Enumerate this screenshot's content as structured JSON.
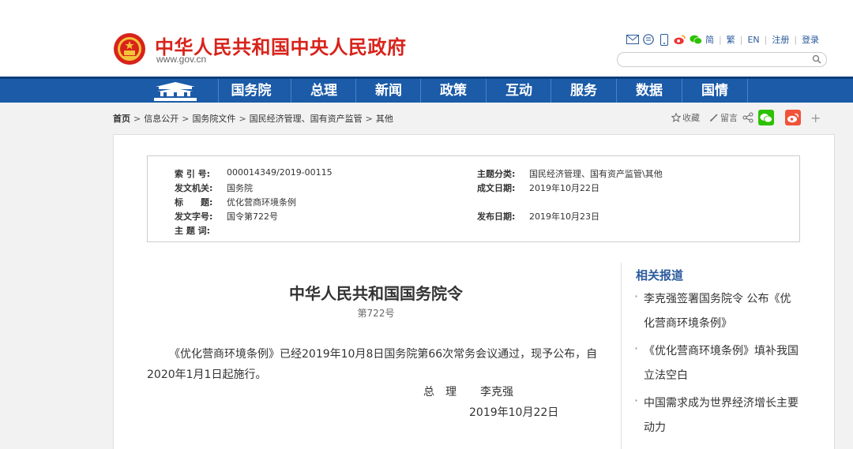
{
  "header": {
    "site_title": "中华人民共和国中央人民政府",
    "site_url": "www.gov.cn",
    "lang_links": [
      "简",
      "繁",
      "EN",
      "注册",
      "登录"
    ],
    "search_placeholder": ""
  },
  "nav": {
    "items": [
      "国务院",
      "总理",
      "新闻",
      "政策",
      "互动",
      "服务",
      "数据",
      "国情"
    ]
  },
  "breadcrumb": {
    "items": [
      "首页",
      "信息公开",
      "国务院文件",
      "国民经济管理、国有资产监管",
      "其他"
    ]
  },
  "share": {
    "favorite": "收藏",
    "comment": "留言"
  },
  "meta": {
    "index_no_label": "索 引 号:",
    "index_no": "000014349/2019-00115",
    "topic_label": "主题分类:",
    "topic": "国民经济管理、国有资产监管\\其他",
    "issuer_label": "发文机关:",
    "issuer": "国务院",
    "created_label": "成文日期:",
    "created": "2019年10月22日",
    "title_label": "标　　题:",
    "title": "优化营商环境条例",
    "doc_no_label": "发文字号:",
    "doc_no": "国令第722号",
    "published_label": "发布日期:",
    "published": "2019年10月23日",
    "keywords_label": "主 题 词:"
  },
  "document": {
    "title": "中华人民共和国国务院令",
    "number": "第722号",
    "body": "《优化营商环境条例》已经2019年10月8日国务院第66次常务会议通过，现予公布，自2020年1月1日起施行。",
    "sign_title": "总　理",
    "sign_name": "李克强",
    "sign_date": "2019年10月22日"
  },
  "related": {
    "heading": "相关报道",
    "items": [
      "李克强签署国务院令 公布《优化营商环境条例》",
      "《优化营商环境条例》填补我国立法空白",
      "中国需求成为世界经济增长主要动力"
    ]
  },
  "colors": {
    "brand_red": "#d8231b",
    "nav_blue": "#1b5ba8",
    "link_blue": "#2a5a9c",
    "wechat_green": "#2dc100",
    "weibo_orange": "#f0533a"
  }
}
